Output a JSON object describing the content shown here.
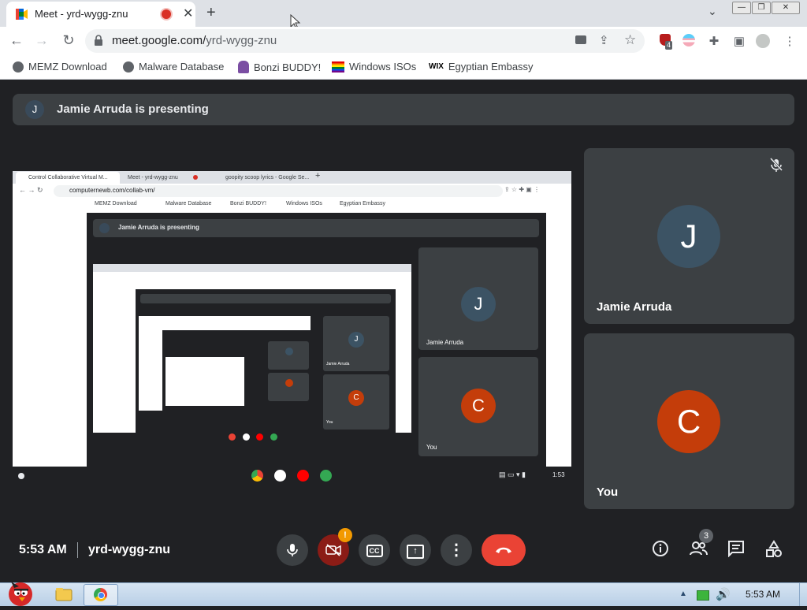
{
  "browser": {
    "tab_title": "Meet - yrd-wygg-znu",
    "url_host": "meet.google.com/",
    "url_path": "yrd-wygg-znu",
    "extension_badge": "4",
    "bookmarks": [
      "MEMZ Download",
      "Malware Database",
      "Bonzi BUDDY!",
      "Windows ISOs",
      "Egyptian Embassy"
    ]
  },
  "meet": {
    "presenting_banner": "Jamie Arruda is presenting",
    "presenter_initial": "J",
    "participants": [
      {
        "initial": "J",
        "name": "Jamie Arruda",
        "avatar_color": "#3c5364",
        "muted": true
      },
      {
        "initial": "C",
        "name": "You",
        "avatar_color": "#c43d0a"
      }
    ],
    "time": "5:53 AM",
    "meeting_code": "yrd-wygg-znu",
    "camera_alert": "!",
    "people_count": "3"
  },
  "shared_screen": {
    "tabs": [
      "Control Collaborative Virtual M...",
      "Meet - yrd-wygg-znu",
      "goopity scoop lyrics - Google Se..."
    ],
    "url": "computernewb.com/collab-vm/",
    "bookmarks": [
      "MEMZ Download",
      "Malware Database",
      "Bonzi BUDDY!",
      "Windows ISOs",
      "Egyptian Embassy"
    ],
    "banner": "Jamie Arruda is presenting",
    "tile1_name": "Jamie Arruda",
    "tile1_initial": "J",
    "tile2_name": "You",
    "tile2_initial": "C",
    "nested_tile1_name": "Jamie Arruda",
    "nested_tile2_name": "You",
    "shelf_time": "1:53"
  },
  "taskbar": {
    "clock": "5:53 AM"
  }
}
